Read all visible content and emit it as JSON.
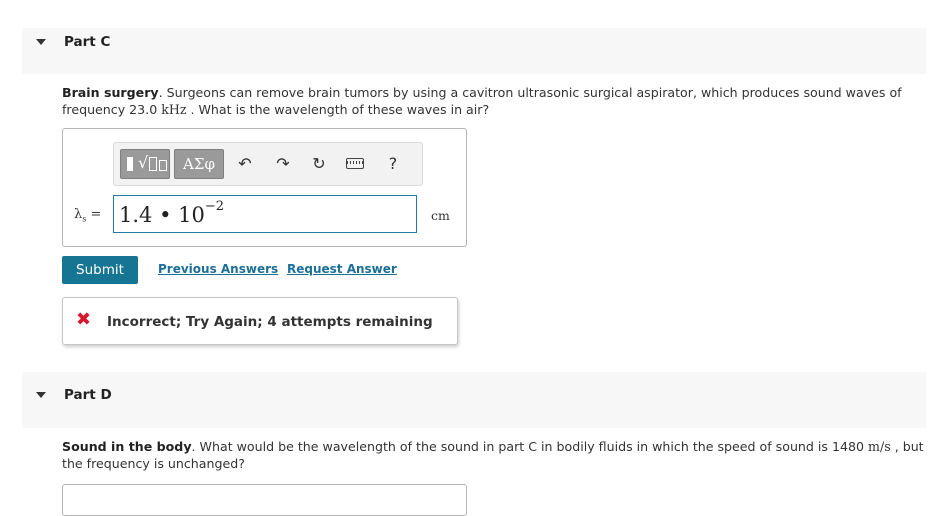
{
  "partC": {
    "title": "Part C",
    "question_bold": "Brain surgery",
    "question_pre": ". Surgeons can remove brain tumors by using a cavitron ultrasonic surgical aspirator, which produces sound waves of frequency 23.0 ",
    "question_unit": "kHz",
    "question_post": " . What is the wavelength of these waves in air?",
    "toolbar": {
      "greek_label": "ΑΣφ",
      "help_label": "?"
    },
    "variable_symbol": "λ",
    "variable_subscript": "s",
    "equals": "=",
    "answer_mantissa": "1.4 • 10",
    "answer_exponent": "−2",
    "unit": "cm",
    "submit_label": "Submit",
    "previous_answers_label": "Previous Answers",
    "request_answer_label": "Request Answer",
    "feedback_text": "Incorrect; Try Again; 4 attempts remaining"
  },
  "partD": {
    "title": "Part D",
    "question_bold": "Sound in the body",
    "question_pre": ". What would be the wavelength of the sound in part C in bodily fluids in which the speed of sound is 1480 ",
    "question_unit": "m/s",
    "question_post": " , but the frequency is unchanged?"
  },
  "colors": {
    "submit": "#177594",
    "link": "#1b6f98",
    "error": "#d6172c",
    "input_border": "#1f7ea8"
  }
}
